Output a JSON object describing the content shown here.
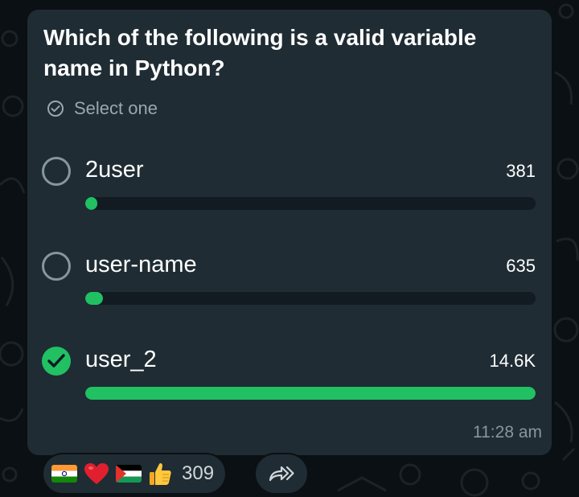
{
  "poll": {
    "question": "Which of the following is a valid variable name in Python?",
    "instruction": "Select one",
    "options": [
      {
        "label": "2user",
        "count": "381",
        "fraction": 0.026,
        "selected": false
      },
      {
        "label": "user-name",
        "count": "635",
        "fraction": 0.04,
        "selected": false
      },
      {
        "label": "user_2",
        "count": "14.6K",
        "fraction": 1.0,
        "selected": true
      }
    ],
    "time": "11:28 am"
  },
  "reactions": {
    "emojis": [
      "india-flag",
      "red-heart",
      "palestine-flag",
      "thumbs-up"
    ],
    "count": "309"
  },
  "colors": {
    "accent": "#21c063",
    "bubble": "#1f2c33",
    "background": "#0b1014"
  }
}
